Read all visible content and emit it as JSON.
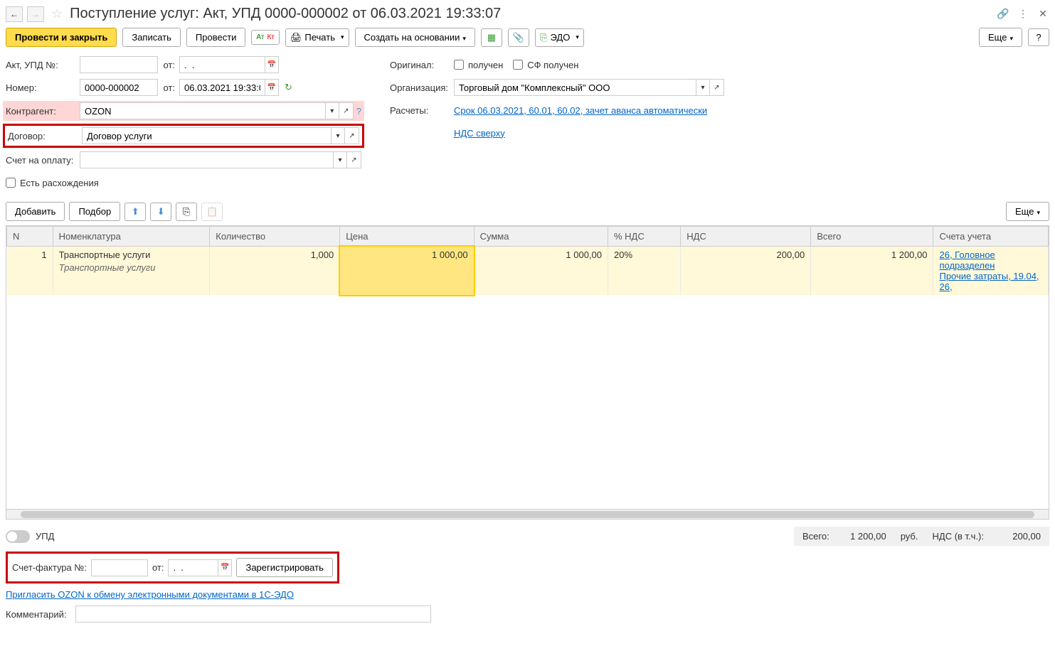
{
  "title": "Поступление услуг: Акт, УПД 0000-000002 от 06.03.2021 19:33:07",
  "toolbar": {
    "post_close": "Провести и закрыть",
    "save": "Записать",
    "post": "Провести",
    "print": "Печать",
    "create_based": "Создать на основании",
    "edo": "ЭДО",
    "more": "Еще"
  },
  "form": {
    "act_label": "Акт, УПД №:",
    "act_value": "",
    "from_label": "от:",
    "act_date": ".  .",
    "number_label": "Номер:",
    "number_value": "0000-000002",
    "number_date": "06.03.2021 19:33:07",
    "counterparty_label": "Контрагент:",
    "counterparty_value": "OZON",
    "contract_label": "Договор:",
    "contract_value": "Договор услуги",
    "invoice_acc_label": "Счет на оплату:",
    "invoice_acc_value": "",
    "discrepancy_label": "Есть расхождения",
    "original_label": "Оригинал:",
    "received": "получен",
    "sf_received": "СФ получен",
    "org_label": "Организация:",
    "org_value": "Торговый дом \"Комплексный\" ООО",
    "calc_label": "Расчеты:",
    "calc_link": "Срок 06.03.2021, 60.01, 60.02, зачет аванса автоматически",
    "vat_link": "НДС сверху"
  },
  "table_toolbar": {
    "add": "Добавить",
    "select": "Подбор",
    "more": "Еще"
  },
  "columns": {
    "n": "N",
    "nomenclature": "Номенклатура",
    "quantity": "Количество",
    "price": "Цена",
    "sum": "Сумма",
    "vat_pct": "% НДС",
    "vat": "НДС",
    "total": "Всего",
    "accounts": "Счета учета"
  },
  "rows": [
    {
      "n": "1",
      "nomenclature": "Транспортные услуги",
      "nomenclature_sub": "Транспортные услуги",
      "quantity": "1,000",
      "price": "1 000,00",
      "sum": "1 000,00",
      "vat_pct": "20%",
      "vat": "200,00",
      "total": "1 200,00",
      "accounts1": "26, Головное подразделен",
      "accounts2": "Прочие затраты, 19.04, 26,"
    }
  ],
  "footer": {
    "upd": "УПД",
    "total_label": "Всего:",
    "total_value": "1 200,00",
    "currency": "руб.",
    "vat_label": "НДС (в т.ч.):",
    "vat_value": "200,00",
    "invoice_label": "Счет-фактура №:",
    "invoice_value": "",
    "invoice_from": "от:",
    "invoice_date": ".  .",
    "register": "Зарегистрировать",
    "edo_link": "Пригласить OZON к обмену электронными документами в 1С-ЭДО",
    "comment_label": "Комментарий:"
  }
}
